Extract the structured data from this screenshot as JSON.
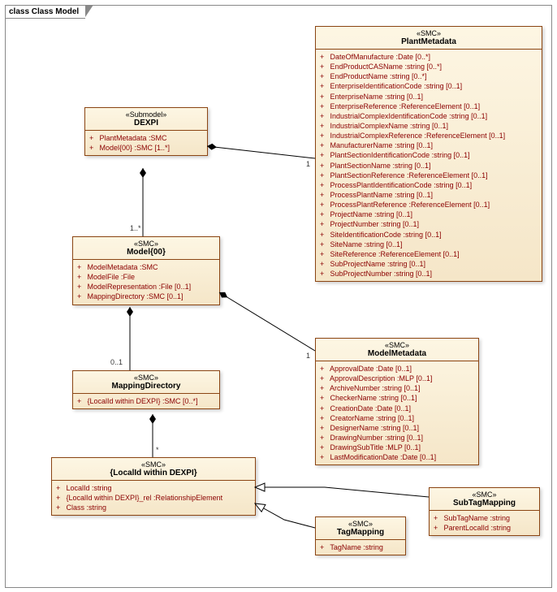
{
  "frame": {
    "title": "class Class Model"
  },
  "dexpi": {
    "stereotype": "«Submodel»",
    "name": "DEXPI",
    "attrs": [
      "PlantMetadata  :SMC",
      "Model{00}  :SMC [1..*]"
    ]
  },
  "model00": {
    "stereotype": "«SMC»",
    "name": "Model{00}",
    "attrs": [
      "ModelMetadata  :SMC",
      "ModelFile  :File",
      "ModelRepresentation  :File [0..1]",
      "MappingDirectory  :SMC [0..1]"
    ]
  },
  "mappingDir": {
    "stereotype": "«SMC»",
    "name": "MappingDirectory",
    "attrs": [
      "{LocalId within DEXPI}  :SMC [0..*]"
    ]
  },
  "localId": {
    "stereotype": "«SMC»",
    "name": "{LocalId within DEXPI}",
    "attrs": [
      "LocalId  :string",
      "{LocalId within DEXPI}_rel  :RelationshipElement",
      "Class  :string"
    ]
  },
  "plantMeta": {
    "stereotype": "«SMC»",
    "name": "PlantMetadata",
    "attrs": [
      "DateOfManufacture  :Date [0..*]",
      "EndProductCASName  :string [0..*]",
      "EndProductName  :string [0..*]",
      "EnterpriseIdentificationCode  :string [0..1]",
      "EnterpriseName  :string [0..1]",
      "EnterpriseReference  :ReferenceElement [0..1]",
      "IndustrialComplexIdentificationCode  :string [0..1]",
      "IndustrialComplexName  :string [0..1]",
      "IndustrialComplexReference  :ReferenceElement [0..1]",
      "ManufacturerName  :string [0..1]",
      "PlantSectionIdentificationCode  :string [0..1]",
      "PlantSectionName  :string [0..1]",
      "PlantSectionReference  :ReferenceElement [0..1]",
      "ProcessPlantIdentificationCode  :string [0..1]",
      "ProcessPlantName  :string [0..1]",
      "ProcessPlantReference  :ReferenceElement [0..1]",
      "ProjectName  :string [0..1]",
      "ProjectNumber  :string [0..1]",
      "SiteIdentificationCode  :string [0..1]",
      "SiteName  :string [0..1]",
      "SiteReference  :ReferenceElement [0..1]",
      "SubProjectName  :string [0..1]",
      "SubProjectNumber  :string [0..1]"
    ]
  },
  "modelMeta": {
    "stereotype": "«SMC»",
    "name": "ModelMetadata",
    "attrs": [
      "ApprovalDate  :Date [0..1]",
      "ApprovalDescription  :MLP [0..1]",
      "ArchiveNumber  :string [0..1]",
      "CheckerName  :string [0..1]",
      "CreationDate  :Date [0..1]",
      "CreatorName  :string [0..1]",
      "DesignerName  :string [0..1]",
      "DrawingNumber  :string [0..1]",
      "DrawingSubTitle  :MLP [0..1]",
      "LastModificationDate  :Date [0..1]"
    ]
  },
  "tagMapping": {
    "stereotype": "«SMC»",
    "name": "TagMapping",
    "attrs": [
      "TagName  :string"
    ]
  },
  "subTagMapping": {
    "stereotype": "«SMC»",
    "name": "SubTagMapping",
    "attrs": [
      "SubTagName  :string",
      "ParentLocalId  :string"
    ]
  },
  "mults": {
    "dexpiModel": "1..*",
    "plantMeta": "1",
    "modelMapping": "0..1",
    "modelMeta": "1",
    "mappingLocal": "*"
  },
  "chart_data": {
    "type": "uml-class-diagram",
    "title": "class Class Model",
    "classes": [
      {
        "name": "DEXPI",
        "stereotype": "Submodel",
        "attributes": [
          {
            "name": "PlantMetadata",
            "type": "SMC",
            "vis": "+"
          },
          {
            "name": "Model{00}",
            "type": "SMC",
            "mult": "1..*",
            "vis": "+"
          }
        ]
      },
      {
        "name": "Model{00}",
        "stereotype": "SMC",
        "attributes": [
          {
            "name": "ModelMetadata",
            "type": "SMC",
            "vis": "+"
          },
          {
            "name": "ModelFile",
            "type": "File",
            "vis": "+"
          },
          {
            "name": "ModelRepresentation",
            "type": "File",
            "mult": "0..1",
            "vis": "+"
          },
          {
            "name": "MappingDirectory",
            "type": "SMC",
            "mult": "0..1",
            "vis": "+"
          }
        ]
      },
      {
        "name": "MappingDirectory",
        "stereotype": "SMC",
        "attributes": [
          {
            "name": "{LocalId within DEXPI}",
            "type": "SMC",
            "mult": "0..*",
            "vis": "+"
          }
        ]
      },
      {
        "name": "{LocalId within DEXPI}",
        "stereotype": "SMC",
        "attributes": [
          {
            "name": "LocalId",
            "type": "string",
            "vis": "+"
          },
          {
            "name": "{LocalId within DEXPI}_rel",
            "type": "RelationshipElement",
            "vis": "+"
          },
          {
            "name": "Class",
            "type": "string",
            "vis": "+"
          }
        ]
      },
      {
        "name": "PlantMetadata",
        "stereotype": "SMC",
        "attributes": [
          {
            "name": "DateOfManufacture",
            "type": "Date",
            "mult": "0..*",
            "vis": "+"
          },
          {
            "name": "EndProductCASName",
            "type": "string",
            "mult": "0..*",
            "vis": "+"
          },
          {
            "name": "EndProductName",
            "type": "string",
            "mult": "0..*",
            "vis": "+"
          },
          {
            "name": "EnterpriseIdentificationCode",
            "type": "string",
            "mult": "0..1",
            "vis": "+"
          },
          {
            "name": "EnterpriseName",
            "type": "string",
            "mult": "0..1",
            "vis": "+"
          },
          {
            "name": "EnterpriseReference",
            "type": "ReferenceElement",
            "mult": "0..1",
            "vis": "+"
          },
          {
            "name": "IndustrialComplexIdentificationCode",
            "type": "string",
            "mult": "0..1",
            "vis": "+"
          },
          {
            "name": "IndustrialComplexName",
            "type": "string",
            "mult": "0..1",
            "vis": "+"
          },
          {
            "name": "IndustrialComplexReference",
            "type": "ReferenceElement",
            "mult": "0..1",
            "vis": "+"
          },
          {
            "name": "ManufacturerName",
            "type": "string",
            "mult": "0..1",
            "vis": "+"
          },
          {
            "name": "PlantSectionIdentificationCode",
            "type": "string",
            "mult": "0..1",
            "vis": "+"
          },
          {
            "name": "PlantSectionName",
            "type": "string",
            "mult": "0..1",
            "vis": "+"
          },
          {
            "name": "PlantSectionReference",
            "type": "ReferenceElement",
            "mult": "0..1",
            "vis": "+"
          },
          {
            "name": "ProcessPlantIdentificationCode",
            "type": "string",
            "mult": "0..1",
            "vis": "+"
          },
          {
            "name": "ProcessPlantName",
            "type": "string",
            "mult": "0..1",
            "vis": "+"
          },
          {
            "name": "ProcessPlantReference",
            "type": "ReferenceElement",
            "mult": "0..1",
            "vis": "+"
          },
          {
            "name": "ProjectName",
            "type": "string",
            "mult": "0..1",
            "vis": "+"
          },
          {
            "name": "ProjectNumber",
            "type": "string",
            "mult": "0..1",
            "vis": "+"
          },
          {
            "name": "SiteIdentificationCode",
            "type": "string",
            "mult": "0..1",
            "vis": "+"
          },
          {
            "name": "SiteName",
            "type": "string",
            "mult": "0..1",
            "vis": "+"
          },
          {
            "name": "SiteReference",
            "type": "ReferenceElement",
            "mult": "0..1",
            "vis": "+"
          },
          {
            "name": "SubProjectName",
            "type": "string",
            "mult": "0..1",
            "vis": "+"
          },
          {
            "name": "SubProjectNumber",
            "type": "string",
            "mult": "0..1",
            "vis": "+"
          }
        ]
      },
      {
        "name": "ModelMetadata",
        "stereotype": "SMC",
        "attributes": [
          {
            "name": "ApprovalDate",
            "type": "Date",
            "mult": "0..1",
            "vis": "+"
          },
          {
            "name": "ApprovalDescription",
            "type": "MLP",
            "mult": "0..1",
            "vis": "+"
          },
          {
            "name": "ArchiveNumber",
            "type": "string",
            "mult": "0..1",
            "vis": "+"
          },
          {
            "name": "CheckerName",
            "type": "string",
            "mult": "0..1",
            "vis": "+"
          },
          {
            "name": "CreationDate",
            "type": "Date",
            "mult": "0..1",
            "vis": "+"
          },
          {
            "name": "CreatorName",
            "type": "string",
            "mult": "0..1",
            "vis": "+"
          },
          {
            "name": "DesignerName",
            "type": "string",
            "mult": "0..1",
            "vis": "+"
          },
          {
            "name": "DrawingNumber",
            "type": "string",
            "mult": "0..1",
            "vis": "+"
          },
          {
            "name": "DrawingSubTitle",
            "type": "MLP",
            "mult": "0..1",
            "vis": "+"
          },
          {
            "name": "LastModificationDate",
            "type": "Date",
            "mult": "0..1",
            "vis": "+"
          }
        ]
      },
      {
        "name": "TagMapping",
        "stereotype": "SMC",
        "attributes": [
          {
            "name": "TagName",
            "type": "string",
            "vis": "+"
          }
        ]
      },
      {
        "name": "SubTagMapping",
        "stereotype": "SMC",
        "attributes": [
          {
            "name": "SubTagName",
            "type": "string",
            "vis": "+"
          },
          {
            "name": "ParentLocalId",
            "type": "string",
            "vis": "+"
          }
        ]
      }
    ],
    "relations": [
      {
        "from": "DEXPI",
        "to": "PlantMetadata",
        "type": "composition",
        "mult": "1"
      },
      {
        "from": "DEXPI",
        "to": "Model{00}",
        "type": "composition",
        "mult": "1..*"
      },
      {
        "from": "Model{00}",
        "to": "ModelMetadata",
        "type": "composition",
        "mult": "1"
      },
      {
        "from": "Model{00}",
        "to": "MappingDirectory",
        "type": "composition",
        "mult": "0..1"
      },
      {
        "from": "MappingDirectory",
        "to": "{LocalId within DEXPI}",
        "type": "composition",
        "mult": "*"
      },
      {
        "from": "TagMapping",
        "to": "{LocalId within DEXPI}",
        "type": "generalization"
      },
      {
        "from": "SubTagMapping",
        "to": "{LocalId within DEXPI}",
        "type": "generalization"
      }
    ]
  }
}
